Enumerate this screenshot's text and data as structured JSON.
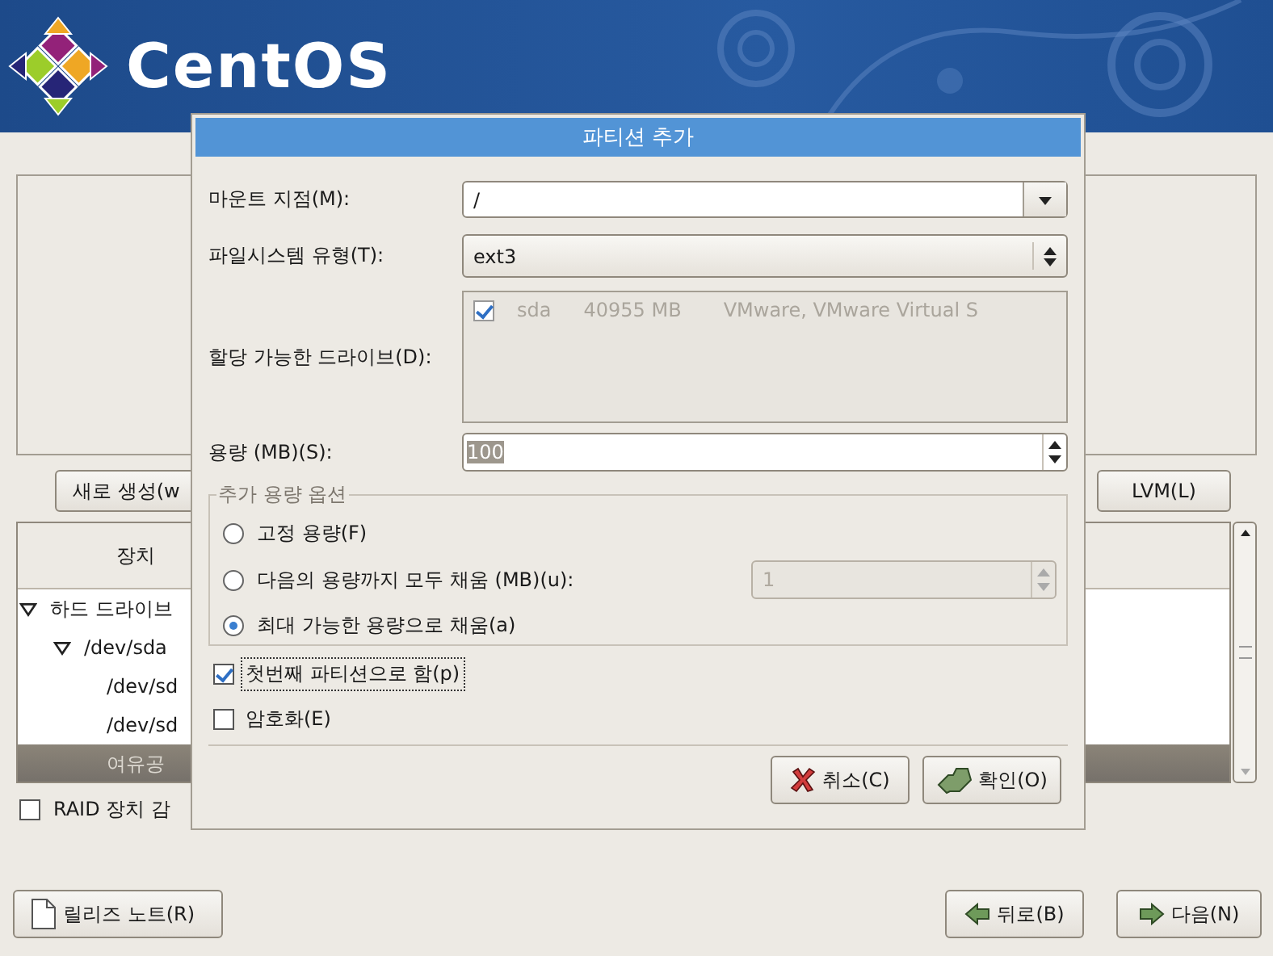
{
  "header": {
    "logo_text": "CentOS"
  },
  "toolbar": {
    "buttons": [
      {
        "label": "새로 생성(w"
      },
      {
        "label": "LVM(L)"
      }
    ]
  },
  "device_table": {
    "columns": [
      "장치"
    ],
    "rows": [
      {
        "device": "하드 드라이브",
        "expanded": true,
        "selected": false,
        "children": [
          {
            "device": "/dev/sda",
            "expanded": true,
            "selected": false,
            "children": [
              {
                "device": "/dev/sd",
                "selected": false
              },
              {
                "device": "/dev/sd",
                "selected": false
              },
              {
                "device": "여유공",
                "selected": true
              }
            ]
          }
        ]
      }
    ]
  },
  "raid_checkbox": {
    "label": "RAID 장치 감",
    "checked": false
  },
  "footer": {
    "buttons": [
      {
        "kind": "notes",
        "label": "릴리즈 노트(R)"
      },
      {
        "kind": "back",
        "label": "뒤로(B)"
      },
      {
        "kind": "next",
        "label": "다음(N)"
      }
    ]
  },
  "dialog": {
    "title": "파티션 추가",
    "fields": [
      {
        "kind": "combo",
        "label": "마운트 지점(M):",
        "value": "/"
      },
      {
        "kind": "select",
        "label": "파일시스템 유형(T):",
        "value": "ext3"
      },
      {
        "kind": "drives",
        "label": "할당 가능한 드라이브(D):",
        "disabled": true,
        "drives": [
          {
            "name": "sda",
            "size": "40955 MB",
            "model": "VMware, VMware Virtual S",
            "checked": true
          }
        ]
      },
      {
        "kind": "spin",
        "label": "용량 (MB)(S):",
        "value": "100",
        "text_selected": true
      }
    ],
    "size_options": {
      "title": "추가 용량 옵션",
      "options": [
        {
          "label": "고정 용량(F)",
          "selected": false
        },
        {
          "label": "다음의 용량까지 모두 채움 (MB)(u):",
          "selected": false,
          "spin_value": "1",
          "spin_disabled": true
        },
        {
          "label": "최대 가능한 용량으로 채움(a)",
          "selected": true
        }
      ]
    },
    "checkboxes": [
      {
        "label": "첫번째 파티션으로 함(p)",
        "checked": true,
        "focused": true
      },
      {
        "label": "암호화(E)",
        "checked": false,
        "focused": false
      }
    ],
    "buttons": [
      {
        "kind": "cancel",
        "label": "취소(C)"
      },
      {
        "kind": "ok",
        "label": "확인(O)"
      }
    ]
  }
}
